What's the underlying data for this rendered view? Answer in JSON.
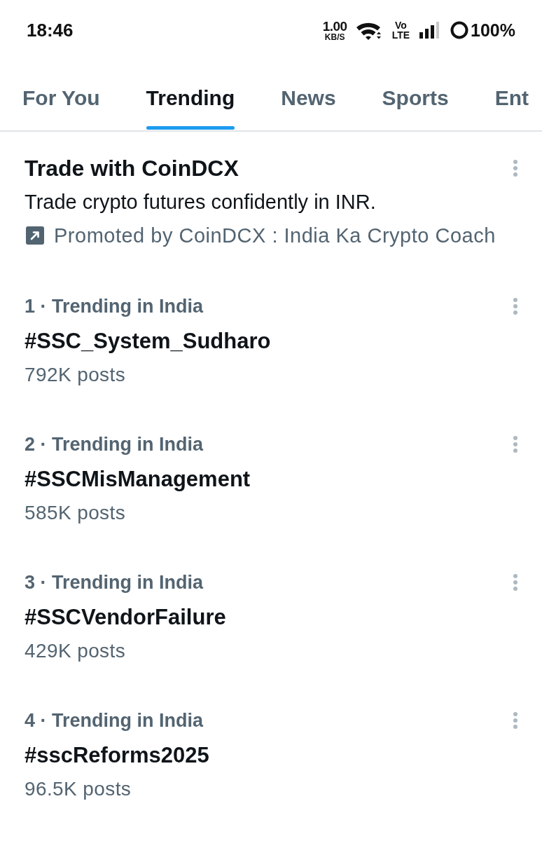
{
  "status_bar": {
    "time": "18:46",
    "net_speed": "1.00",
    "net_speed_unit": "KB/S",
    "volte_top": "Vo",
    "volte_bottom": "LTE",
    "battery": "100%"
  },
  "tabs": [
    {
      "label": "For You",
      "selected": false
    },
    {
      "label": "Trending",
      "selected": true
    },
    {
      "label": "News",
      "selected": false
    },
    {
      "label": "Sports",
      "selected": false
    },
    {
      "label": "Ent",
      "selected": false
    }
  ],
  "promoted_trend": {
    "title": "Trade with CoinDCX",
    "description": "Trade crypto futures confidently in INR.",
    "promoted_by": "Promoted by CoinDCX : India Ka Crypto Coach"
  },
  "trends": [
    {
      "category": "1 · Trending in India",
      "hashtag": "#SSC_System_Sudharo",
      "posts": "792K posts"
    },
    {
      "category": "2 · Trending in India",
      "hashtag": "#SSCMisManagement",
      "posts": "585K posts"
    },
    {
      "category": "3 · Trending in India",
      "hashtag": "#SSCVendorFailure",
      "posts": "429K posts"
    },
    {
      "category": "4 · Trending in India",
      "hashtag": "#sscReforms2025",
      "posts": "96.5K posts"
    }
  ]
}
